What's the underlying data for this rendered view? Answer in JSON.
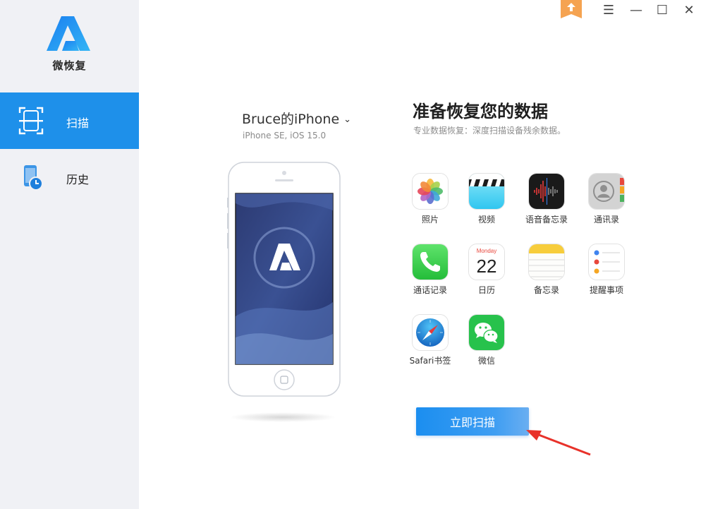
{
  "app": {
    "name": "微恢复"
  },
  "sidebar": {
    "items": [
      {
        "label": "扫描",
        "active": true
      },
      {
        "label": "历史",
        "active": false
      }
    ]
  },
  "window": {
    "controls": [
      "upload-icon",
      "menu-icon",
      "minimize-icon",
      "maximize-icon",
      "close-icon"
    ],
    "menu_glyph": "☰",
    "minimize_glyph": "—",
    "maximize_glyph": "☐",
    "close_glyph": "✕"
  },
  "device": {
    "name": "Bruce的iPhone",
    "details": "iPhone SE,  iOS 15.0"
  },
  "main": {
    "title": "准备恢复您的数据",
    "subtitle": "专业数据恢复：深度扫描设备残余数据。",
    "scan_button": "立即扫描",
    "categories": [
      {
        "label": "照片",
        "icon": "photos-icon"
      },
      {
        "label": "视频",
        "icon": "video-clapper-icon"
      },
      {
        "label": "语音备忘录",
        "icon": "voice-memo-icon"
      },
      {
        "label": "通讯录",
        "icon": "contacts-icon"
      },
      {
        "label": "通话记录",
        "icon": "phone-icon"
      },
      {
        "label": "日历",
        "icon": "calendar-icon",
        "weekday": "Monday",
        "day": "22"
      },
      {
        "label": "备忘录",
        "icon": "notes-icon"
      },
      {
        "label": "提醒事项",
        "icon": "reminders-icon"
      },
      {
        "label": "Safari书签",
        "icon": "safari-icon"
      },
      {
        "label": "微信",
        "icon": "wechat-icon"
      }
    ]
  },
  "colors": {
    "accent": "#1e90ea",
    "sidebar_bg": "#f0f1f5",
    "arrow": "#e8322a"
  }
}
